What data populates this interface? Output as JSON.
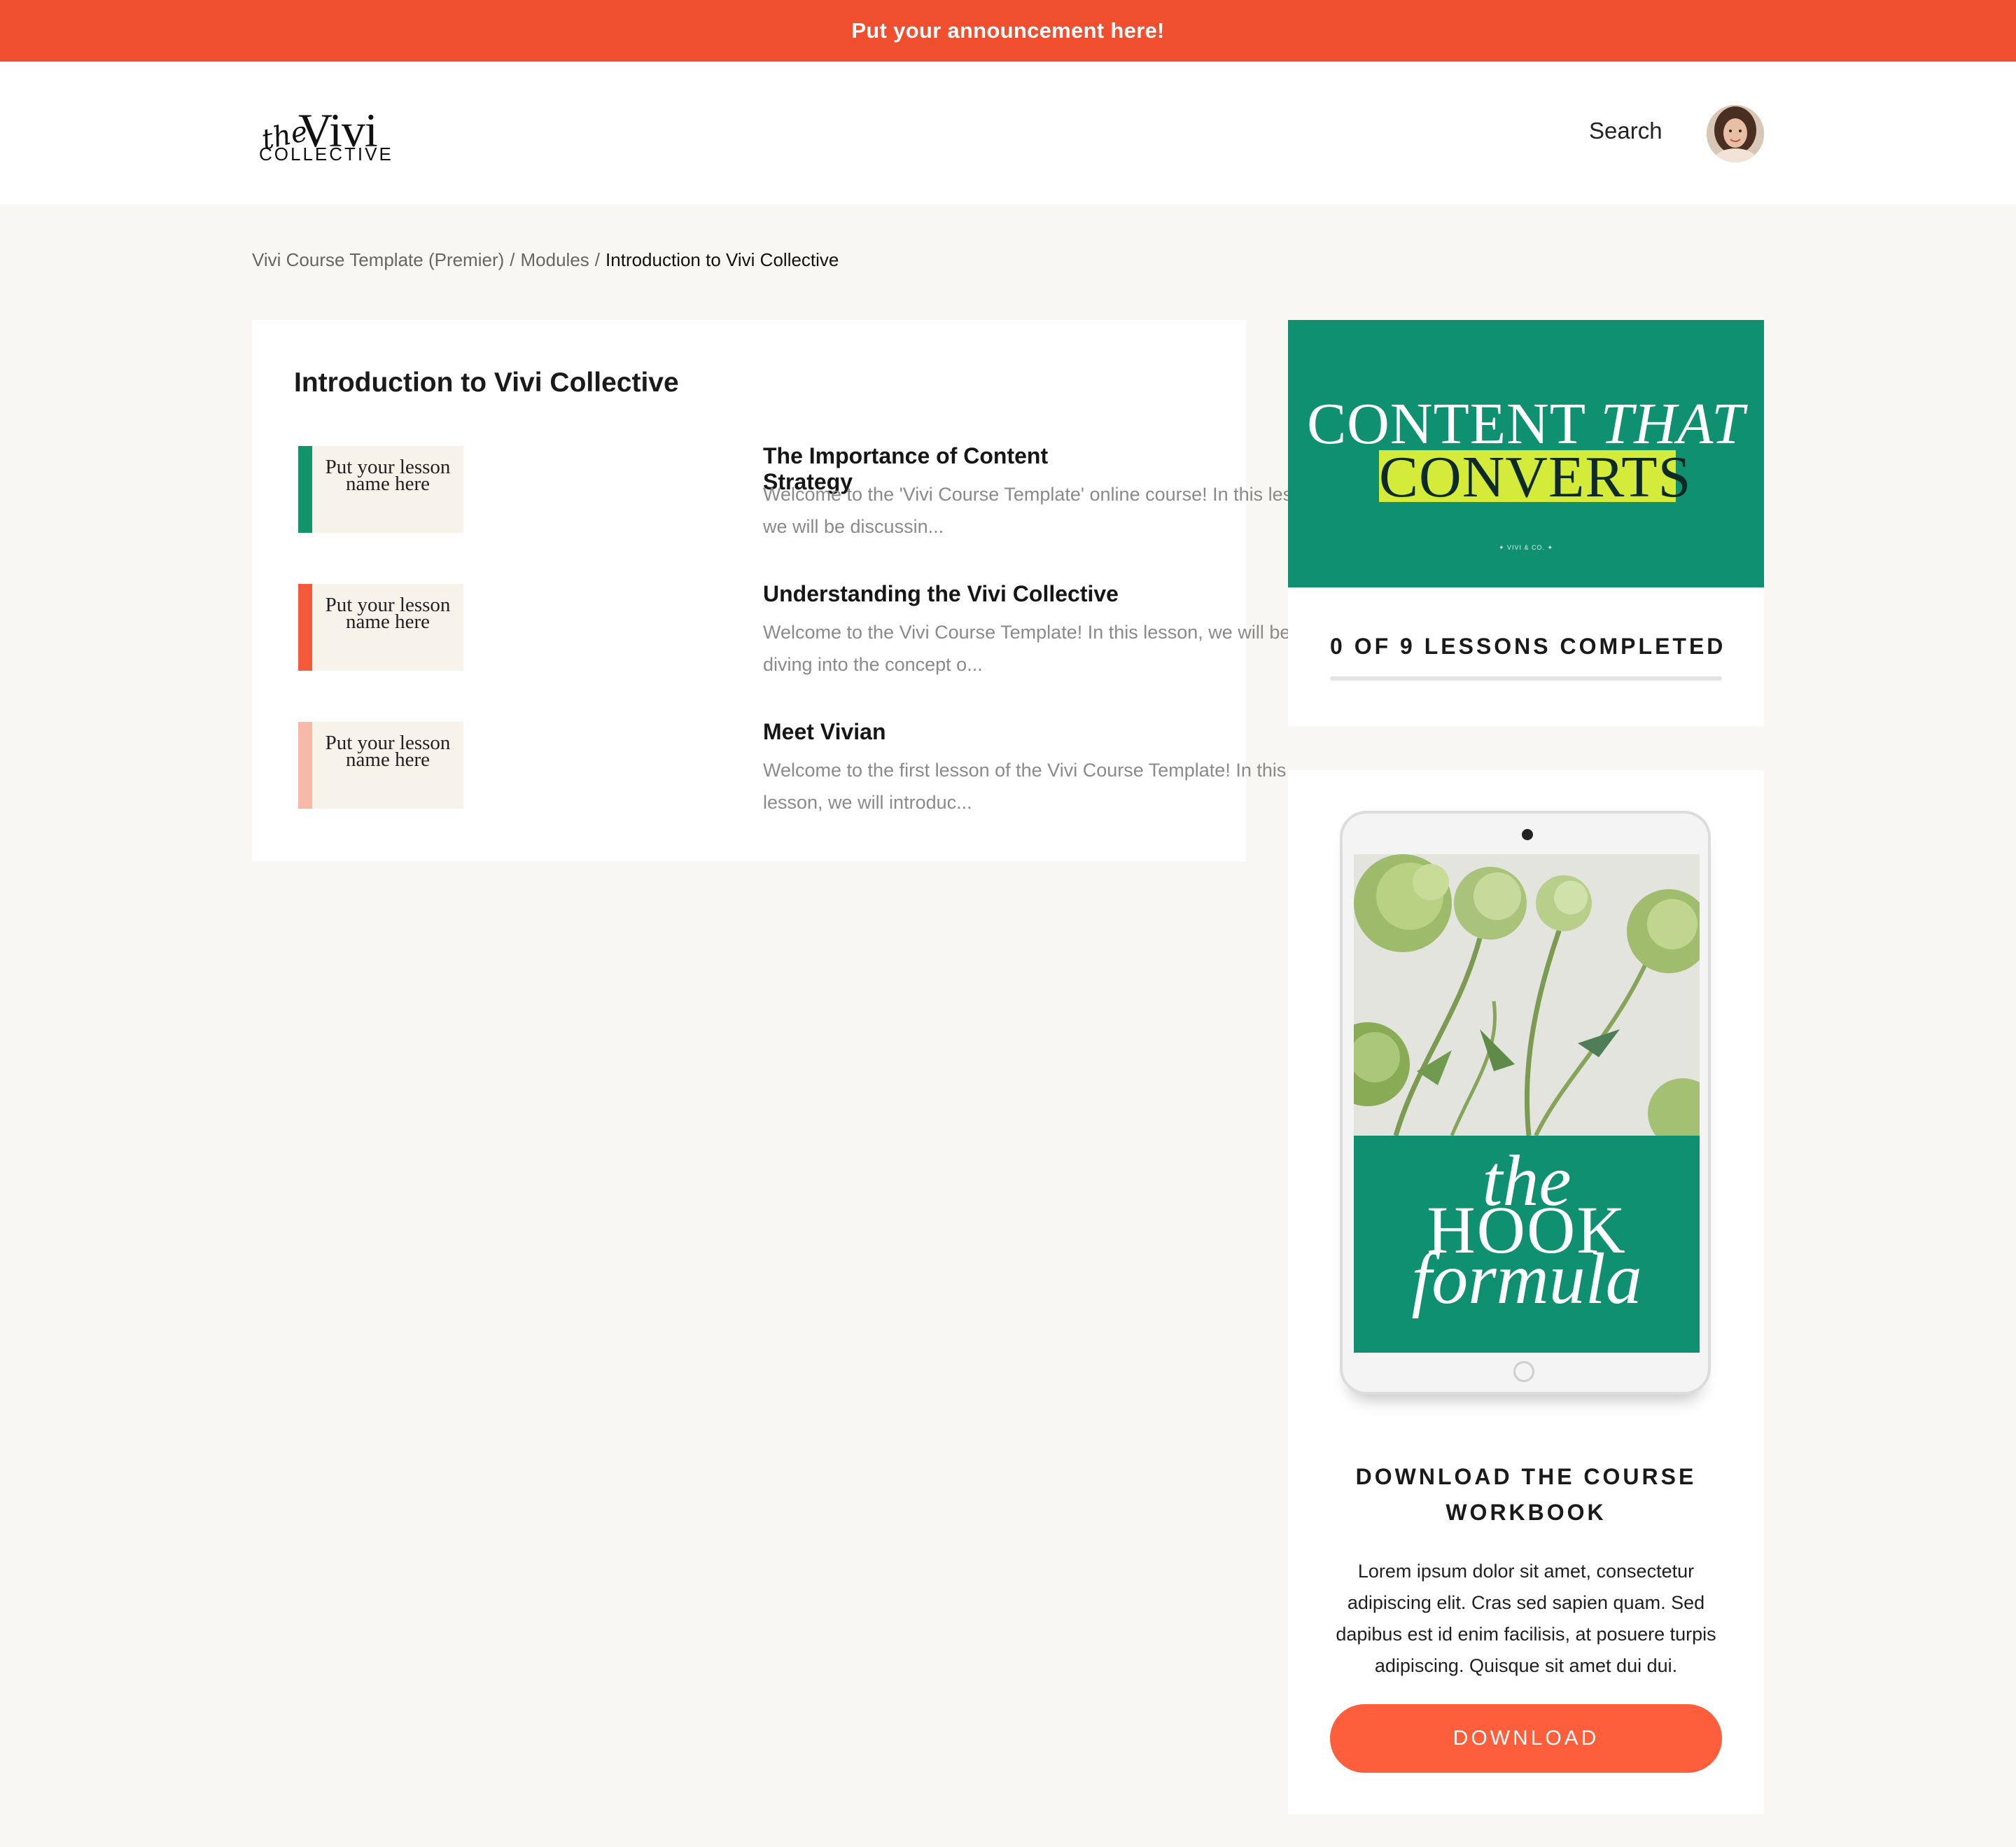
{
  "announcement": "Put your announcement here!",
  "header": {
    "logo": {
      "script": "the",
      "name": "Vivi",
      "sub": "COLLECTIVE"
    },
    "search_label": "Search"
  },
  "breadcrumb": {
    "course": "Vivi Course Template (Premier)",
    "modules": "Modules",
    "separator": "/",
    "current": "Introduction to Vivi Collective"
  },
  "module": {
    "title": "Introduction to Vivi Collective",
    "lessons": [
      {
        "thumb_text": "Put your lesson name here",
        "bar_color": "#13936c",
        "title": "The Importance of Content Strategy",
        "desc": "Welcome to the 'Vivi Course Template' online course! In this lesson, we will be discussin..."
      },
      {
        "thumb_text": "Put your lesson name here",
        "bar_color": "#f4593a",
        "title": "Understanding the Vivi Collective",
        "desc": "Welcome to the Vivi Course Template! In this lesson, we will be diving into the concept o..."
      },
      {
        "thumb_text": "Put your lesson name here",
        "bar_color": "#f9b9a8",
        "title": "Meet Vivian",
        "desc": "Welcome to the first lesson of the Vivi Course Template! In this lesson, we will introduc..."
      }
    ]
  },
  "progress": {
    "cover": {
      "line1": "CONTENT",
      "line1_italic": "THAT",
      "line2": "CONVERTS",
      "small": "✦ VIVI & CO. ✦"
    },
    "text": "0 OF 9 LESSONS COMPLETED",
    "completed": 0,
    "total": 9
  },
  "workbook": {
    "cover": {
      "the": "the",
      "big": "HOOK",
      "formula": "formula"
    },
    "title": "DOWNLOAD THE COURSE WORKBOOK",
    "desc": "Lorem ipsum dolor sit amet, consectetur adipiscing elit. Cras sed sapien quam. Sed dapibus est id enim facilisis, at posuere turpis adipiscing. Quisque sit amet dui dui.",
    "button": "DOWNLOAD"
  },
  "colors": {
    "announcement_bg": "#ef4f2e",
    "brand_green": "#0f9070",
    "highlight_lime": "#d5eb3a",
    "download_button": "#fd5e3c",
    "page_bg": "#f9f7f3"
  }
}
